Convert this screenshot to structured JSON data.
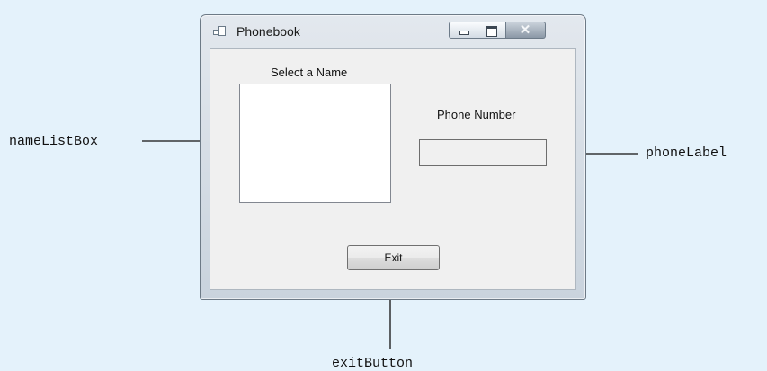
{
  "window": {
    "title": "Phonebook",
    "icon": "app-window-icon",
    "caption_buttons": {
      "minimize": "minimize-icon",
      "maximize": "maximize-icon",
      "close_glyph": "✕"
    }
  },
  "form": {
    "select_label": "Select a Name",
    "phone_label": "Phone Number",
    "exit_button": "Exit"
  },
  "callouts": {
    "name_list_box": "nameListBox",
    "phone_label": "phoneLabel",
    "exit_button": "exitButton"
  },
  "colors": {
    "background": "#e4f2fb",
    "client": "#f0f0f0"
  }
}
